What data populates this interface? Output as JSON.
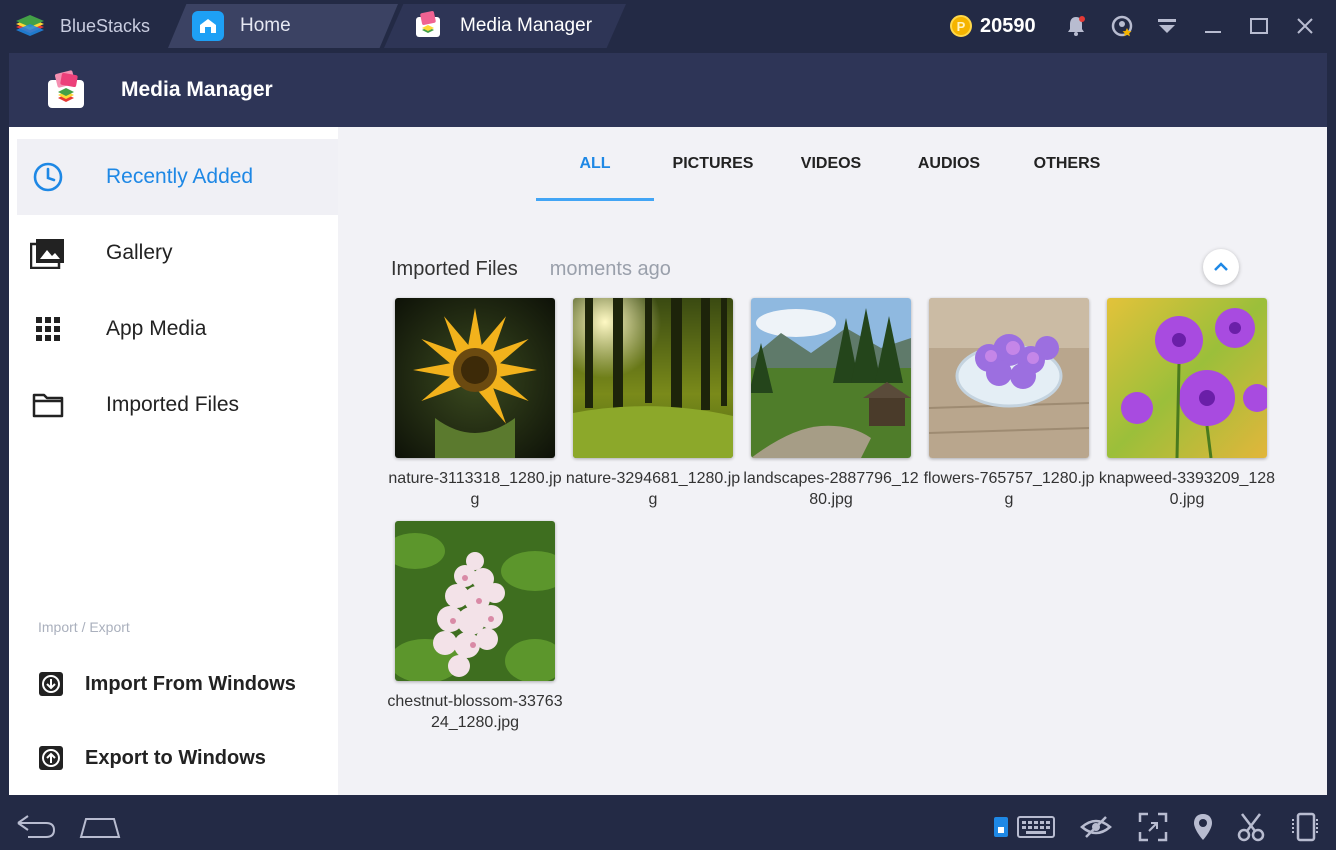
{
  "titlebar": {
    "brand": "BlueStacks",
    "tabs": [
      {
        "label": "Home",
        "icon": "home-icon"
      },
      {
        "label": "Media Manager",
        "icon": "media-manager-icon"
      }
    ],
    "coins": "20590"
  },
  "app": {
    "title": "Media Manager"
  },
  "sidebar": {
    "items": [
      {
        "label": "Recently Added",
        "icon": "clock-icon",
        "active": true
      },
      {
        "label": "Gallery",
        "icon": "gallery-icon"
      },
      {
        "label": "App Media",
        "icon": "grid-icon"
      },
      {
        "label": "Imported Files",
        "icon": "folder-icon"
      }
    ],
    "section_label": "Import / Export",
    "import_label": "Import From Windows",
    "export_label": "Export to Windows"
  },
  "tabs": [
    "ALL",
    "PICTURES",
    "VIDEOS",
    "AUDIOS",
    "OTHERS"
  ],
  "active_tab": "ALL",
  "content": {
    "section_title": "Imported Files",
    "section_time": "moments ago",
    "files": [
      {
        "name": "nature-3113318_1280.jpg"
      },
      {
        "name": "nature-3294681_1280.jpg"
      },
      {
        "name": "landscapes-2887796_1280.jpg"
      },
      {
        "name": "flowers-765757_1280.jpg"
      },
      {
        "name": "knapweed-3393209_1280.jpg"
      },
      {
        "name": "chestnut-blossom-3376324_1280.jpg"
      }
    ]
  },
  "colors": {
    "accent": "#1e88e5",
    "header": "#2e3557",
    "frame": "#232a45"
  }
}
